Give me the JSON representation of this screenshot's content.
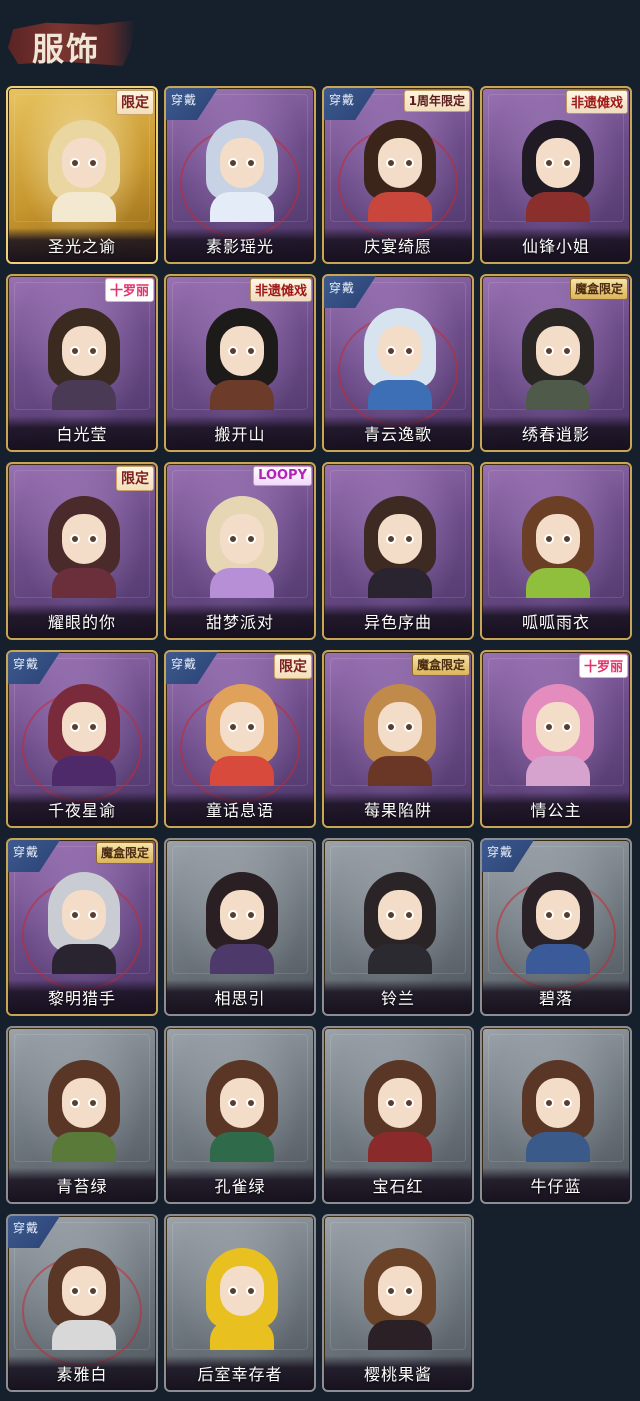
{
  "section": {
    "title": "服饰"
  },
  "badges": {
    "worn": "穿戴"
  },
  "items": [
    {
      "name": "圣光之谕",
      "tag": "限定",
      "tag_type": "limited",
      "worn": false,
      "tier": "gold",
      "hair": "#e9d6a0",
      "body": "#f3e8d0"
    },
    {
      "name": "素影瑶光",
      "tag": "",
      "tag_type": "",
      "worn": true,
      "tier": "purple",
      "hair": "#c7d3e4",
      "body": "#e4ecf7"
    },
    {
      "name": "庆宴绮愿",
      "tag": "1周年限定",
      "tag_type": "anniv",
      "worn": true,
      "tier": "purple",
      "hair": "#3b241a",
      "body": "#c8463c"
    },
    {
      "name": "仙锋小姐",
      "tag": "非遗傩戏",
      "tag_type": "heritage",
      "worn": false,
      "tier": "purple",
      "hair": "#1f1a24",
      "body": "#8a2f2b"
    },
    {
      "name": "白光莹",
      "tag": "十罗丽",
      "tag_type": "loli",
      "worn": false,
      "tier": "purple",
      "hair": "#3a2a20",
      "body": "#4b3a55"
    },
    {
      "name": "搬开山",
      "tag": "非遗傩戏",
      "tag_type": "heritage",
      "worn": false,
      "tier": "purple",
      "hair": "#1d1a1a",
      "body": "#6d3b2a"
    },
    {
      "name": "青云逸歌",
      "tag": "",
      "tag_type": "",
      "worn": true,
      "tier": "purple",
      "hair": "#d8e3f0",
      "body": "#3c6fb5"
    },
    {
      "name": "绣春逍影",
      "tag": "魔盒限定",
      "tag_type": "magicbox",
      "worn": false,
      "tier": "purple",
      "hair": "#2a2624",
      "body": "#4f5a4a"
    },
    {
      "name": "耀眼的你",
      "tag": "限定",
      "tag_type": "limited",
      "worn": false,
      "tier": "purple",
      "hair": "#4a2a2a",
      "body": "#6a2f3a"
    },
    {
      "name": "甜梦派对",
      "tag": "LOOPY",
      "tag_type": "loopy",
      "worn": false,
      "tier": "purple",
      "hair": "#e7d6b4",
      "body": "#b68fd6"
    },
    {
      "name": "异色序曲",
      "tag": "",
      "tag_type": "",
      "worn": false,
      "tier": "purple",
      "hair": "#3d2a22",
      "body": "#2a2430"
    },
    {
      "name": "呱呱雨衣",
      "tag": "",
      "tag_type": "",
      "worn": false,
      "tier": "purple",
      "hair": "#6b3f26",
      "body": "#8fbf3c"
    },
    {
      "name": "千夜星谕",
      "tag": "",
      "tag_type": "",
      "worn": true,
      "tier": "purple",
      "hair": "#7a2b3b",
      "body": "#4e2a6a"
    },
    {
      "name": "童话息语",
      "tag": "限定",
      "tag_type": "limited",
      "worn": true,
      "tier": "purple",
      "hair": "#e0a25a",
      "body": "#d84a3c"
    },
    {
      "name": "莓果陷阱",
      "tag": "魔盒限定",
      "tag_type": "magicbox",
      "worn": false,
      "tier": "purple",
      "hair": "#c08a4a",
      "body": "#6a3626"
    },
    {
      "name": "情公主",
      "tag": "十罗丽",
      "tag_type": "loli",
      "worn": false,
      "tier": "purple",
      "hair": "#e58cbf",
      "body": "#d6a3cf"
    },
    {
      "name": "黎明猎手",
      "tag": "魔盒限定",
      "tag_type": "magicbox",
      "worn": true,
      "tier": "purple",
      "hair": "#c9ccd3",
      "body": "#2a2430"
    },
    {
      "name": "相思引",
      "tag": "",
      "tag_type": "",
      "worn": false,
      "tier": "gray",
      "hair": "#2a2024",
      "body": "#4e3a6a"
    },
    {
      "name": "铃兰",
      "tag": "",
      "tag_type": "",
      "worn": false,
      "tier": "gray",
      "hair": "#2b2426",
      "body": "#2a2a30"
    },
    {
      "name": "碧落",
      "tag": "",
      "tag_type": "",
      "worn": true,
      "tier": "gray",
      "hair": "#2a2226",
      "body": "#3a5a9a"
    },
    {
      "name": "青苔绿",
      "tag": "",
      "tag_type": "",
      "worn": false,
      "tier": "gray",
      "hair": "#5a3626",
      "body": "#5a7a3a"
    },
    {
      "name": "孔雀绿",
      "tag": "",
      "tag_type": "",
      "worn": false,
      "tier": "gray",
      "hair": "#5a3626",
      "body": "#2f6a4a"
    },
    {
      "name": "宝石红",
      "tag": "",
      "tag_type": "",
      "worn": false,
      "tier": "gray",
      "hair": "#5a3626",
      "body": "#8a2a2a"
    },
    {
      "name": "牛仔蓝",
      "tag": "",
      "tag_type": "",
      "worn": false,
      "tier": "gray",
      "hair": "#5a3626",
      "body": "#3a5a8a"
    },
    {
      "name": "素雅白",
      "tag": "",
      "tag_type": "",
      "worn": true,
      "tier": "gray",
      "hair": "#5a3626",
      "body": "#d8d8d8"
    },
    {
      "name": "后室幸存者",
      "tag": "",
      "tag_type": "",
      "worn": false,
      "tier": "gray",
      "hair": "#e8c020",
      "body": "#e8c020"
    },
    {
      "name": "樱桃果酱",
      "tag": "",
      "tag_type": "",
      "worn": false,
      "tier": "gray",
      "hair": "#6a4228",
      "body": "#2a2026"
    }
  ]
}
